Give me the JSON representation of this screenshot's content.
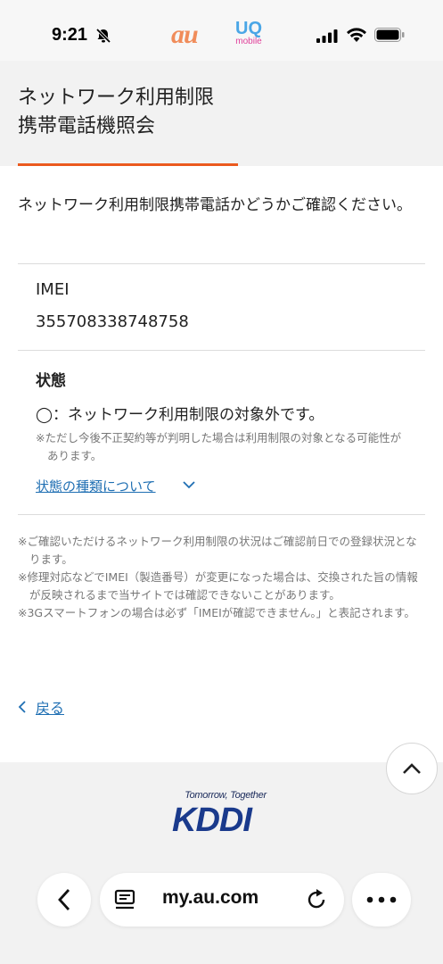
{
  "status_bar": {
    "time": "9:21",
    "carrier_au": "au",
    "carrier_uq": "UQ",
    "carrier_uq_sub": "mobile"
  },
  "header": {
    "title_line1": "ネットワーク利用制限",
    "title_line2": "携帯電話機照会",
    "accent_color": "#eb5a1e"
  },
  "intro": "ネットワーク利用制限携帯電話かどうかご確認ください。",
  "imei": {
    "label": "IMEI",
    "value": "355708338748758"
  },
  "status": {
    "label": "状態",
    "value": "◯：ネットワーク利用制限の対象外です。",
    "note": "※ただし今後不正契約等が判明した場合は利用制限の対象となる可能性があります。",
    "link": "状態の種類について"
  },
  "notes": [
    "※ご確認いただけるネットワーク利用制限の状況はご確認前日での登録状況となります。",
    "※修理対応などでIMEI（製造番号）が変更になった場合は、交換された旨の情報が反映されるまで当サイトでは確認できないことがあります。",
    "※3Gスマートフォンの場合は必ず「IMEIが確認できません。」と表記されます。"
  ],
  "back_link": "戻る",
  "footer": {
    "tagline": "Tomorrow, Together",
    "logo": "KDDI"
  },
  "browser": {
    "url": "my.au.com"
  }
}
